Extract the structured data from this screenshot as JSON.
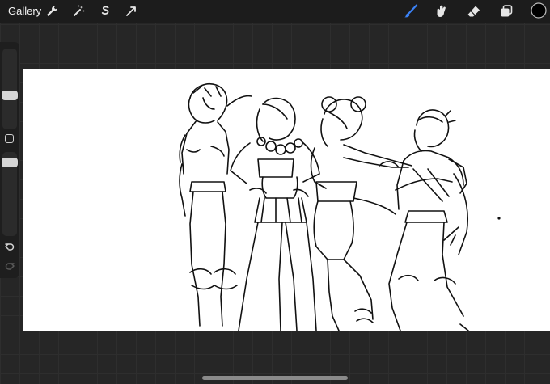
{
  "topbar": {
    "gallery_label": "Gallery",
    "left_tools": [
      "wrench-icon",
      "magic-wand-icon",
      "selection-s-icon",
      "transform-arrow-icon"
    ],
    "right_tools": [
      "brush-icon",
      "smudge-icon",
      "eraser-icon",
      "layers-icon",
      "color-swatch"
    ],
    "active_tool": "brush-icon",
    "accent_color": "#3b82f6",
    "current_color": "#000000"
  },
  "sidebar": {
    "brush_size_level": 0.3,
    "opacity_level": 0.8,
    "undo_icon": "undo-icon",
    "redo_icon": "redo-icon"
  },
  "canvas": {
    "background": "#ffffff",
    "content": "line-art-drawing"
  }
}
